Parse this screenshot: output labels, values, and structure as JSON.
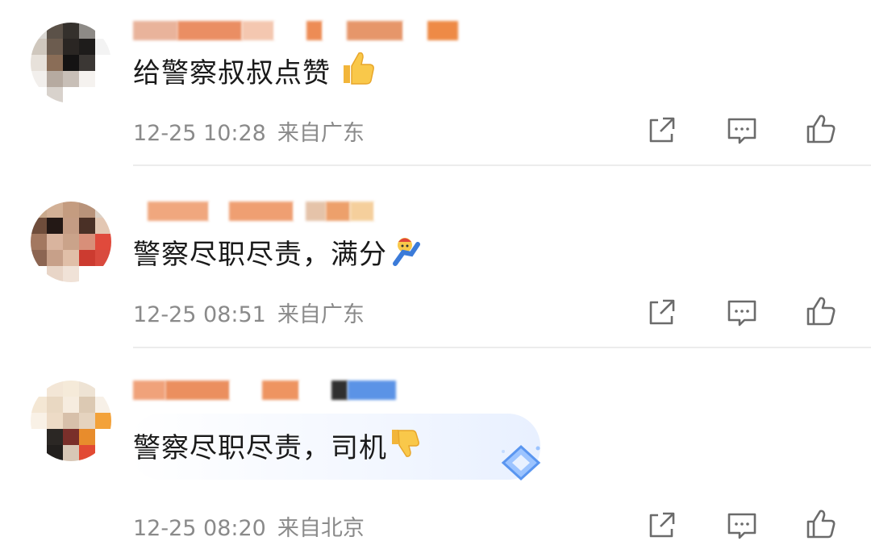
{
  "comments": [
    {
      "text": "给警察叔叔点赞",
      "emoji": "thumbs-up-emoji",
      "date": "12-25 10:28",
      "location": "来自广东"
    },
    {
      "text": "警察尽职尽责，满分",
      "emoji": "cheer-emoji",
      "date": "12-25 08:51",
      "location": "来自广东"
    },
    {
      "text": "警察尽职尽责，司机",
      "emoji": "thumbs-down-emoji",
      "date": "12-25 08:20",
      "location": "来自北京"
    }
  ],
  "icons": {
    "share": "share-icon",
    "reply": "comment-icon",
    "like": "like-icon",
    "badge": "diamond-badge-icon"
  },
  "colors": {
    "text": "#1a1a1a",
    "meta": "#8a8a8a",
    "icon": "#6b6b6b",
    "divider": "#ececec"
  }
}
